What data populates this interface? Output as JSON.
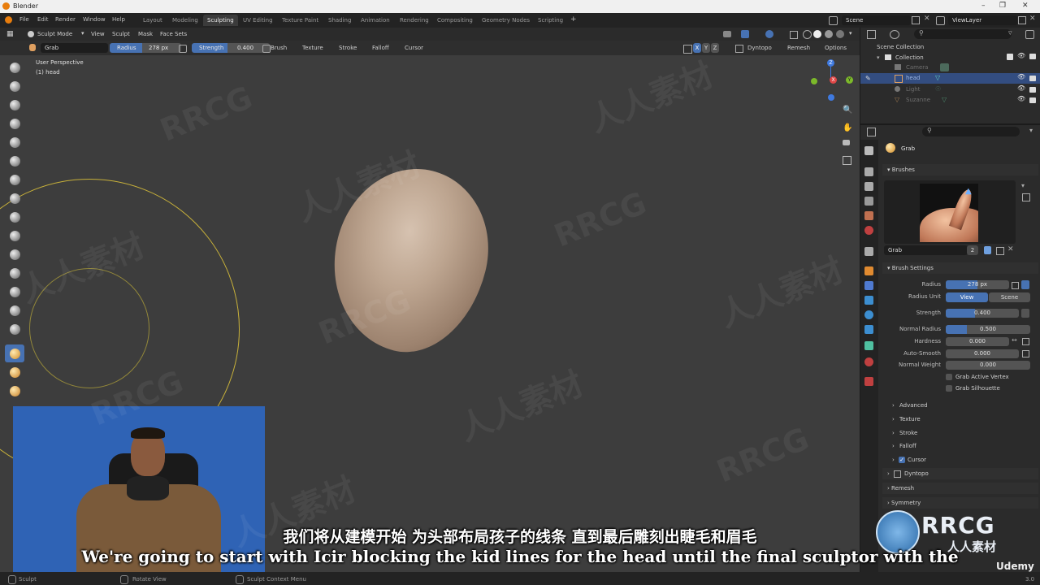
{
  "window": {
    "title": "Blender"
  },
  "menubar": {
    "menus": [
      "File",
      "Edit",
      "Render",
      "Window",
      "Help"
    ],
    "workspaces": [
      "Layout",
      "Modeling",
      "Sculpting",
      "UV Editing",
      "Texture Paint",
      "Shading",
      "Animation",
      "Rendering",
      "Compositing",
      "Geometry Nodes",
      "Scripting"
    ],
    "active_workspace": "Sculpting",
    "add_tab": "+",
    "scene": "Scene",
    "view_layer": "ViewLayer"
  },
  "header": {
    "mode": "Sculpt Mode",
    "menus": [
      "View",
      "Sculpt",
      "Mask",
      "Face Sets"
    ],
    "brush_name": "Grab",
    "radius_label": "Radius",
    "radius_value": "278 px",
    "strength_label": "Strength",
    "strength_value": "0.400",
    "dropdowns": [
      "Brush",
      "Texture",
      "Stroke",
      "Falloff",
      "Cursor"
    ],
    "axes": [
      "X",
      "Y",
      "Z"
    ],
    "right_menus": [
      "Dyntopo",
      "Remesh",
      "Options"
    ]
  },
  "viewport": {
    "view_name": "User Perspective",
    "object_name": "(1) head",
    "gizmo_axes": [
      "Z",
      "X",
      "Y"
    ]
  },
  "outliner": {
    "root": "Scene Collection",
    "collection": "Collection",
    "items": [
      {
        "name": "Camera",
        "selected": false
      },
      {
        "name": "head",
        "selected": true
      },
      {
        "name": "Light",
        "selected": false
      },
      {
        "name": "Suzanne",
        "selected": false
      }
    ]
  },
  "properties": {
    "active_brush": "Grab",
    "brushes_panel": "Brushes",
    "brush_slot_name": "Grab",
    "brush_users": "2",
    "brush_settings_panel": "Brush Settings",
    "rows": [
      {
        "label": "Radius",
        "value": "278 px",
        "fill": 0.5
      },
      {
        "label": "Radius Unit",
        "value": ""
      },
      {
        "label": "Strength",
        "value": "0.400",
        "fill": 0.4
      },
      {
        "label": "Normal Radius",
        "value": "0.500",
        "fill": 0.25
      },
      {
        "label": "Hardness",
        "value": "0.000",
        "fill": 0
      },
      {
        "label": "Auto-Smooth",
        "value": "0.000",
        "fill": 0
      },
      {
        "label": "Normal Weight",
        "value": "0.000",
        "fill": 0
      }
    ],
    "radius_unit_options": [
      "View",
      "Scene"
    ],
    "checkboxes": [
      "Grab Active Vertex",
      "Grab Silhouette"
    ],
    "subpanels": [
      "Advanced",
      "Texture",
      "Stroke",
      "Falloff",
      "Cursor"
    ],
    "panels": [
      "Dyntopo",
      "Remesh",
      "Symmetry"
    ]
  },
  "statusbar": {
    "items": [
      "Sculpt",
      "Rotate View",
      "Sculpt Context Menu"
    ],
    "version": "3.0"
  },
  "subtitles": {
    "chinese": "我们将从建模开始 为头部布局孩子的线条 直到最后雕刻出睫毛和眉毛",
    "english": "We're going to start with Icir blocking the kid lines for the head until the final sculptor with the"
  },
  "watermarks": {
    "brand": "RRCG",
    "brand_cn": "人人素材",
    "site": "Udemy"
  },
  "colors": {
    "accent": "#4772b3",
    "brush_circle": "#c8b13a",
    "object": "#b59a86",
    "webcam_bg": "#2f63b5"
  }
}
